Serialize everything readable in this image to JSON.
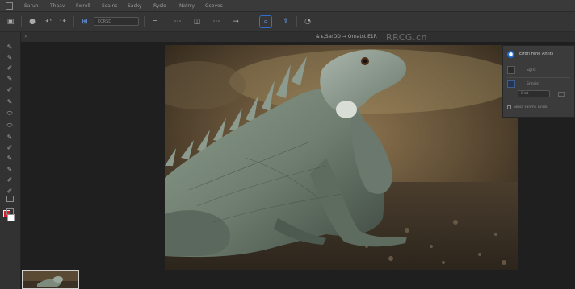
{
  "menu": {
    "items": [
      "Saruh",
      "Thaav",
      "Fwrell",
      "Scains",
      "Sacky",
      "Ryslo",
      "Natrry",
      "Gsoves"
    ]
  },
  "options": {
    "preset_label": "ECRSD"
  },
  "document": {
    "title": "& ε,SarDD → Ornatst E1R",
    "watermark": "RRCG.cn"
  },
  "panel": {
    "title": "Elrdn Fene Annts",
    "row1": "Sgrst",
    "row2": "Snnsist",
    "field_label": "Dlot",
    "checkbox_label": "Slnsa Fanmy Anrlo"
  },
  "colors": {
    "foreground": "#d3202b",
    "background": "#ffffff",
    "accent": "#1f6fe0"
  }
}
